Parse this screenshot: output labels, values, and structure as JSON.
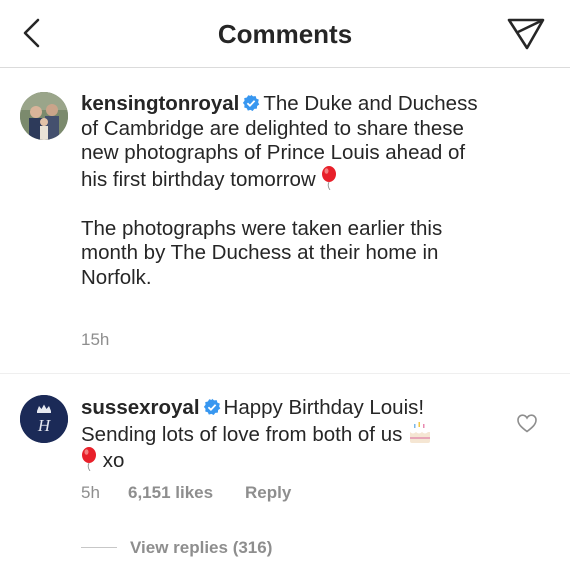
{
  "header": {
    "title": "Comments"
  },
  "comments": [
    {
      "username": "kensingtonroyal",
      "text_part1": "The Duke and Duchess of Cambridge are delighted to share these new photographs of Prince Louis ahead of his first birthday tomorrow",
      "text_part2": "The photographs were taken earlier this month by The Duchess at their home in Norfolk.",
      "time": "15h",
      "avatar_icon": "family-photo-avatar",
      "emoji": "balloon-icon"
    },
    {
      "username": "sussexroyal",
      "text_a": "Happy Birthday Louis! Sending lots of love from both of us",
      "text_b": "xo",
      "time": "5h",
      "likes": "6,151 likes",
      "reply_label": "Reply",
      "view_replies": "View replies (316)",
      "avatar_icon": "crown-monogram-avatar"
    }
  ],
  "colors": {
    "verified": "#3897f0",
    "muted": "#8e8e8e",
    "text": "#262626",
    "balloon": "#e8202a"
  }
}
